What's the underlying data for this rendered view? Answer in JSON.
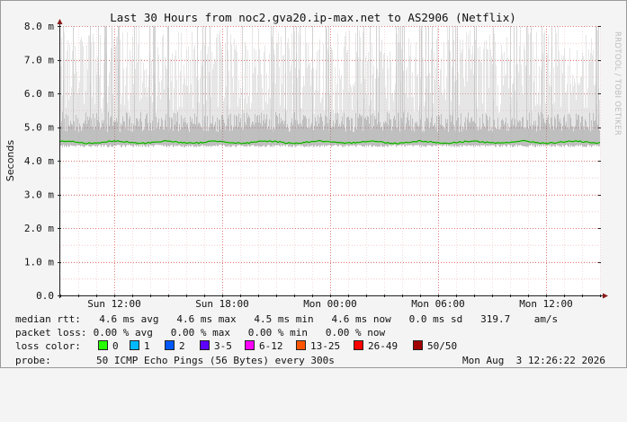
{
  "chart_data": {
    "type": "line",
    "title": "Last 30 Hours from noc2.gva20.ip-max.net to AS2906 (Netflix)",
    "ylabel": "Seconds",
    "side_label": "RRDTOOL / TOBI OETIKER",
    "ylim": [
      0,
      8.0
    ],
    "y_ticks": [
      {
        "value": 0.0,
        "label": "0.0"
      },
      {
        "value": 1.0,
        "label": "1.0 m"
      },
      {
        "value": 2.0,
        "label": "2.0 m"
      },
      {
        "value": 3.0,
        "label": "3.0 m"
      },
      {
        "value": 4.0,
        "label": "4.0 m"
      },
      {
        "value": 5.0,
        "label": "5.0 m"
      },
      {
        "value": 6.0,
        "label": "6.0 m"
      },
      {
        "value": 7.0,
        "label": "7.0 m"
      },
      {
        "value": 8.0,
        "label": "8.0 m"
      }
    ],
    "x_range_hours": [
      0,
      30
    ],
    "x_ticks": [
      {
        "hour": 3,
        "label": "Sun 12:00"
      },
      {
        "hour": 9,
        "label": "Sun 18:00"
      },
      {
        "hour": 15,
        "label": "Mon 00:00"
      },
      {
        "hour": 21,
        "label": "Mon 06:00"
      },
      {
        "hour": 27,
        "label": "Mon 12:00"
      }
    ],
    "grid": true,
    "series": [
      {
        "name": "median rtt",
        "color": "#00cc00",
        "typical_value": 4.6,
        "min": 4.5,
        "max": 4.6
      }
    ],
    "smoke_range": [
      4.4,
      8.0
    ]
  },
  "stats": {
    "median_label": "median rtt:",
    "median_values": "  4.6 ms avg   4.6 ms max   4.5 ms min   4.6 ms now   0.0 ms sd   319.7    am/s",
    "loss_label": "packet loss:",
    "loss_values": " 0.00 % avg   0.00 % max   0.00 % min   0.00 % now",
    "color_label": "loss color:",
    "probe_label": "probe:",
    "probe_values": "50 ICMP Echo Pings (56 Bytes) every 300s",
    "timestamp": "Mon Aug  3 12:26:22 2026"
  },
  "loss_colors": [
    {
      "label": "0",
      "color": "#26ff00"
    },
    {
      "label": "1",
      "color": "#00b8ff"
    },
    {
      "label": "2",
      "color": "#0059ff"
    },
    {
      "label": "3-5",
      "color": "#5e00ff"
    },
    {
      "label": "6-12",
      "color": "#ff00ff"
    },
    {
      "label": "13-25",
      "color": "#ff5500"
    },
    {
      "label": "26-49",
      "color": "#ff0000"
    },
    {
      "label": "50/50",
      "color": "#a10000"
    }
  ]
}
